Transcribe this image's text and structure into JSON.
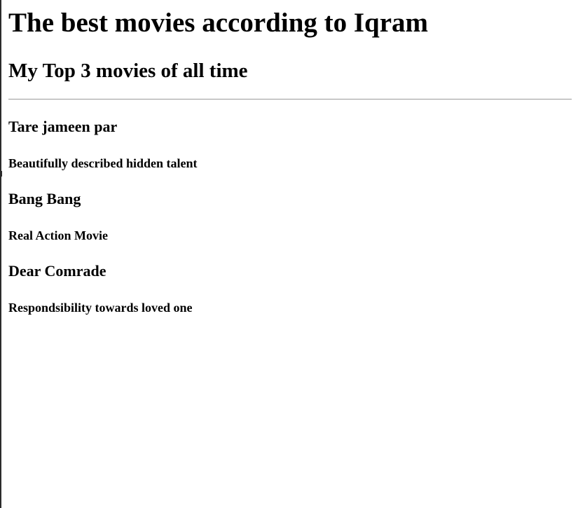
{
  "page": {
    "title": "The best movies according to Iqram",
    "subtitle": "My Top 3 movies of all time"
  },
  "movies": [
    {
      "title": "Tare jameen par",
      "description": "Beautifully described hidden talent"
    },
    {
      "title": "Bang Bang",
      "description": "Real Action Movie"
    },
    {
      "title": "Dear Comrade",
      "description": "Respondsibility towards loved one"
    }
  ]
}
